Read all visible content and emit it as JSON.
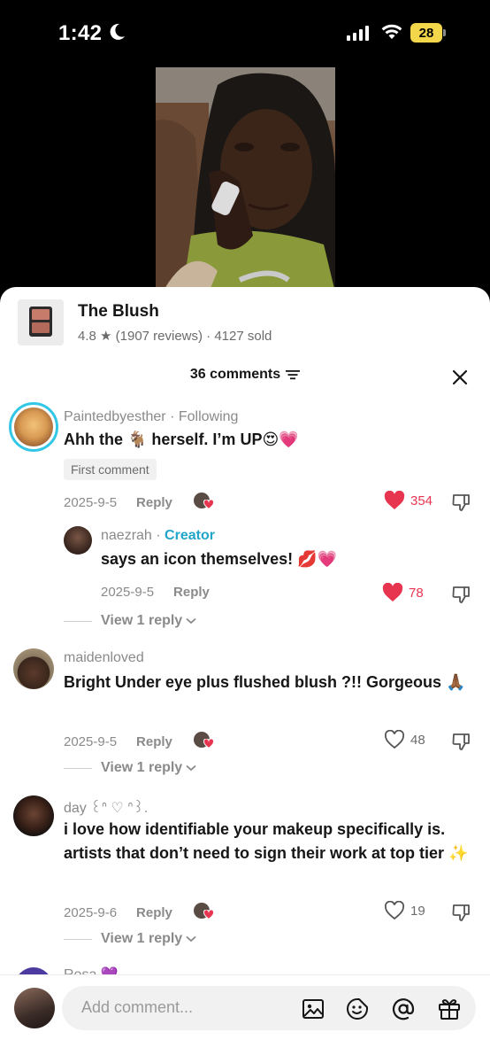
{
  "status": {
    "time": "1:42",
    "battery": "28"
  },
  "product": {
    "name": "The Blush",
    "meta": "4.8 ★ (1907 reviews) · 4127 sold"
  },
  "comments_header": {
    "count": "36 comments"
  },
  "comments": [
    {
      "username": "Paintedbyesther",
      "relation": "· Following",
      "text": "Ahh the 🐐 herself. I’m UP😍💗",
      "badge": "First comment",
      "date": "2025-9-5",
      "reply_label": "Reply",
      "likes": "354",
      "liked": true
    },
    {
      "username": "naezrah",
      "role": "Creator",
      "text": "says an icon themselves! 💋💗",
      "date": "2025-9-5",
      "reply_label": "Reply",
      "likes": "78",
      "liked": true
    },
    {
      "username": "maidenloved",
      "text": "Bright Under eye plus flushed blush ?!! Gorgeous 🙏🏾",
      "date": "2025-9-5",
      "reply_label": "Reply",
      "likes": "48",
      "liked": false
    },
    {
      "username": "day ꒰ᐢ ♡ ᐢ꒱.",
      "text": "i love how identifiable your makeup specifically is. artists that don’t need to sign their work at top tier ✨",
      "date": "2025-9-6",
      "reply_label": "Reply",
      "likes": "19",
      "liked": false
    },
    {
      "username": "Rosa 💜"
    }
  ],
  "view_reply_label": "View 1 reply",
  "input": {
    "placeholder": "Add comment..."
  },
  "icons": [
    "moon-icon",
    "signal-icon",
    "wifi-icon",
    "battery-icon",
    "filter-icon",
    "close-icon",
    "heart-icon",
    "dislike-icon",
    "chevron-down-icon",
    "image-icon",
    "emoji-icon",
    "at-icon",
    "gift-icon"
  ],
  "colors": {
    "like_red": "#e8354f",
    "creator_blue": "#22a5c9",
    "battery_yellow": "#f4d64a"
  }
}
